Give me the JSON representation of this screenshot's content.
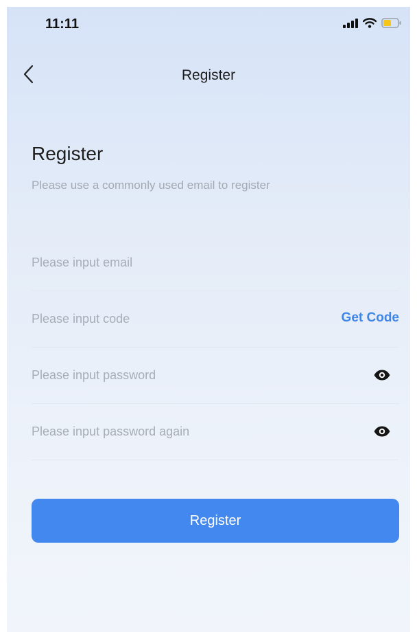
{
  "status_bar": {
    "time": "11:11",
    "icons": [
      "signal-icon",
      "wifi-icon",
      "battery-icon"
    ],
    "battery_color": "#f5c518"
  },
  "nav": {
    "back_icon": "chevron-left-icon",
    "title": "Register"
  },
  "form": {
    "heading": "Register",
    "subheading": "Please use a commonly used email to register",
    "fields": [
      {
        "name": "email",
        "value": "",
        "placeholder": "Please input email"
      },
      {
        "name": "code",
        "value": "",
        "placeholder": "Please input code",
        "action_label": "Get Code"
      },
      {
        "name": "password",
        "value": "",
        "placeholder": "Please input password",
        "icon": "eye-icon"
      },
      {
        "name": "password_again",
        "value": "",
        "placeholder": "Please input password again",
        "icon": "eye-icon"
      }
    ],
    "submit_label": "Register"
  },
  "colors": {
    "accent": "#4388ee",
    "link": "#3f86e6",
    "background_top": "#d6e3f7",
    "background_bottom": "#f1f5fb"
  }
}
